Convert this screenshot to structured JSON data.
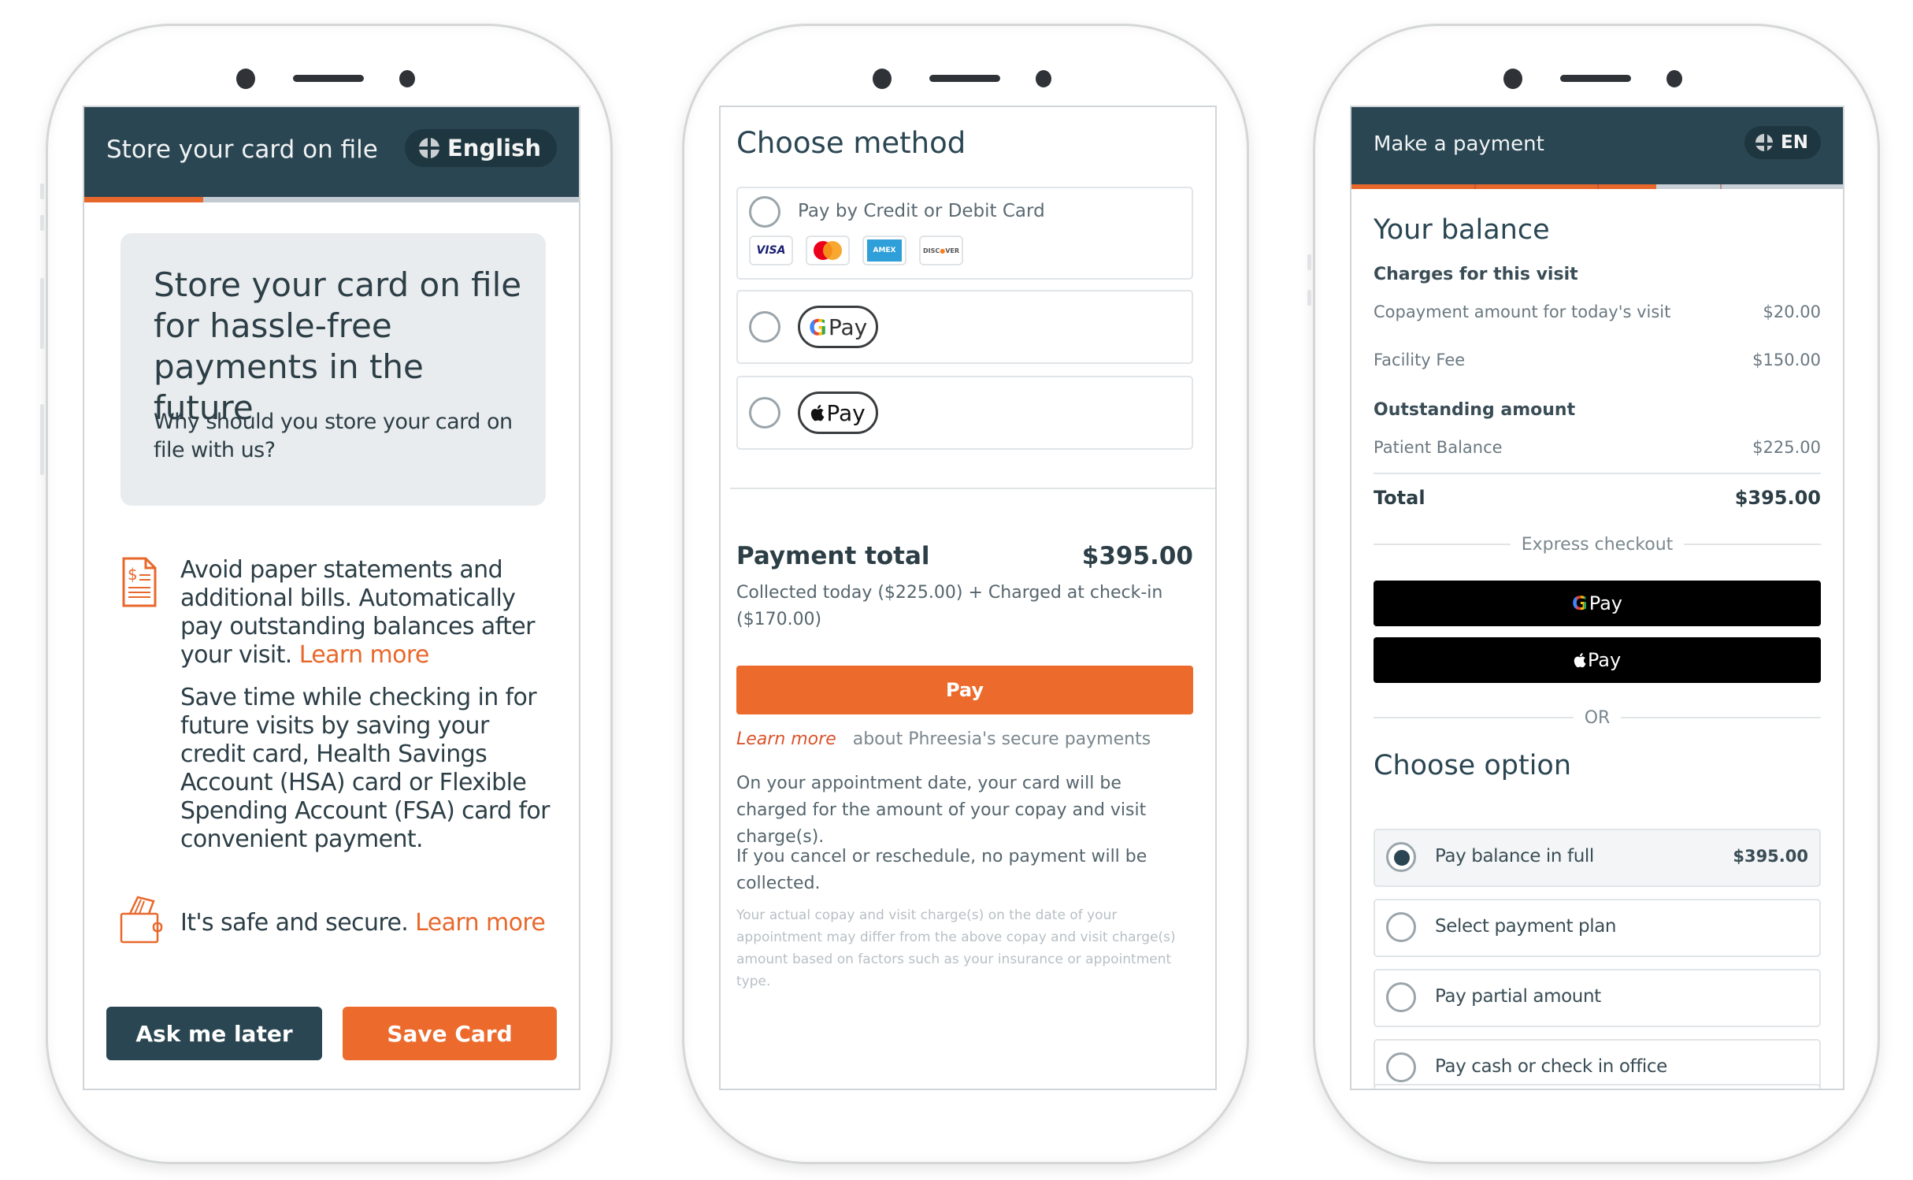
{
  "phones": {
    "left": {
      "header_title": "Store your card on file",
      "language_label": "English",
      "progress_fraction": 0.24,
      "hero_title": "Store your card on file for hassle-free payments in the future",
      "hero_subtitle": "Why should you store your card on file with us?",
      "benefit_1_text": "Avoid paper statements and additional bills. Automatically pay outstanding balances after your visit.",
      "benefit_1_link": "Learn more",
      "benefit_2_text": "Save time while checking in for future visits by saving your credit card, Health Savings Account (HSA) card or Flexible Spending Account (FSA) card for convenient payment.",
      "benefit_3_text": "It's safe and secure.",
      "benefit_3_link": "Learn more",
      "ask_later_label": "Ask me later",
      "save_card_label": "Save Card",
      "icons": [
        "invoice-dollar-icon",
        "wallet-card-icon",
        "globe-icon"
      ]
    },
    "middle": {
      "title": "Choose method",
      "methods": [
        {
          "label": "Pay by Credit or Debit Card",
          "selected": false,
          "card_brands": [
            "VISA",
            "Mastercard",
            "AMEX",
            "DISCOVER"
          ]
        },
        {
          "label": "G Pay",
          "selected": false
        },
        {
          "label": "Pay",
          "selected": false
        }
      ],
      "total_label": "Payment total",
      "total_amount": "$395.00",
      "breakdown": "Collected today ($225.00) + Charged at  check-in ($170.00)",
      "pay_label": "Pay",
      "learn_more_link": "Learn more",
      "learn_more_suffix": "about Phreesia's secure payments",
      "note_1": "On your appointment date, your card will be charged for the amount of your copay and visit charge(s).",
      "note_2": "If you cancel or reschedule, no payment will be collected.",
      "disclaimer": "Your actual copay and visit charge(s) on the date of your appointment may differ from the above copay and visit charge(s) amount based on factors such as your insurance or appointment type."
    },
    "right": {
      "header_title": "Make a payment",
      "language_label": "EN",
      "progress_fraction": 0.62,
      "progress_segments": 4,
      "balance_title": "Your balance",
      "charges_heading": "Charges for this visit",
      "charges": [
        {
          "label": "Copayment amount for today's visit",
          "amount": "$20.00"
        },
        {
          "label": "Facility Fee",
          "amount": "$150.00"
        }
      ],
      "outstanding_heading": "Outstanding amount",
      "outstanding": [
        {
          "label": "Patient Balance",
          "amount": "$225.00"
        }
      ],
      "total_label": "Total",
      "total_amount": "$395.00",
      "express_label": "Express checkout",
      "gpay_label": "Pay",
      "applepay_label": "Pay",
      "or_label": "OR",
      "choose_title": "Choose option",
      "options": [
        {
          "label": "Pay balance in full",
          "amount": "$395.00",
          "selected": true
        },
        {
          "label": "Select payment plan",
          "amount": "",
          "selected": false
        },
        {
          "label": "Pay partial amount",
          "amount": "",
          "selected": false
        },
        {
          "label": "Pay cash or check in office",
          "amount": "",
          "selected": false
        }
      ]
    }
  },
  "colors": {
    "header": "#2a4652",
    "accent": "#e8682c",
    "text": "#2c3e46"
  }
}
